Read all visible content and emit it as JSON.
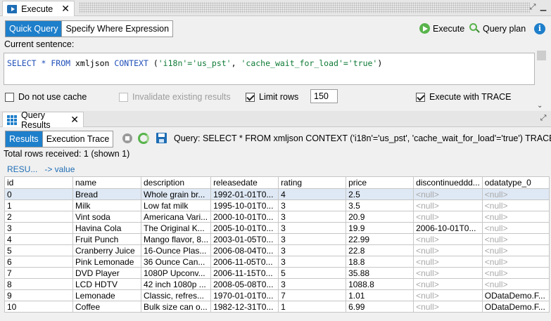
{
  "execute_panel": {
    "tab_title": "Execute",
    "mode_tabs": [
      "Quick Query",
      "Specify Where Expression"
    ],
    "execute_label": "Execute",
    "query_plan_label": "Query plan",
    "info_label": "i",
    "current_sentence_label": "Current sentence:",
    "sql": {
      "kw1": "SELECT",
      "star": "*",
      "kw2": "FROM",
      "table": "xmljson",
      "kw3": "CONTEXT",
      "open": "(",
      "arg1": "'i18n'='us_pst'",
      "comma": ",",
      "arg2": "'cache_wait_for_load'='true'",
      "close": ")"
    },
    "options": {
      "no_cache": "Do not use cache",
      "invalidate": "Invalidate existing results",
      "limit_rows": "Limit rows",
      "limit_value": "150",
      "trace": "Execute with TRACE"
    }
  },
  "results_panel": {
    "tab_title": "Query Results",
    "view_tabs": [
      "Results",
      "Execution Trace"
    ],
    "query_text": "Query: SELECT * FROM xmljson CONTEXT ('i18n'='us_pst', 'cache_wait_for_load'='true') TRACE",
    "total_rows": "Total rows received: 1 (shown 1)",
    "breadcrumb": [
      "RESU...",
      "-> value"
    ],
    "columns": [
      "id",
      "name",
      "description",
      "releasedate",
      "rating",
      "price",
      "discontinueddd...",
      "odatatype_0"
    ],
    "rows": [
      [
        "0",
        "Bread",
        "Whole grain br...",
        "1992-01-01T0...",
        "4",
        "2.5",
        "<null>",
        "<null>"
      ],
      [
        "1",
        "Milk",
        "Low fat milk",
        "1995-10-01T0...",
        "3",
        "3.5",
        "<null>",
        "<null>"
      ],
      [
        "2",
        "Vint soda",
        "Americana Vari...",
        "2000-10-01T0...",
        "3",
        "20.9",
        "<null>",
        "<null>"
      ],
      [
        "3",
        "Havina Cola",
        "The Original K...",
        "2005-10-01T0...",
        "3",
        "19.9",
        "2006-10-01T0...",
        "<null>"
      ],
      [
        "4",
        "Fruit Punch",
        "Mango flavor, 8...",
        "2003-01-05T0...",
        "3",
        "22.99",
        "<null>",
        "<null>"
      ],
      [
        "5",
        "Cranberry Juice",
        "16-Ounce Plas...",
        "2006-08-04T0...",
        "3",
        "22.8",
        "<null>",
        "<null>"
      ],
      [
        "6",
        "Pink Lemonade",
        "36 Ounce Can...",
        "2006-11-05T0...",
        "3",
        "18.8",
        "<null>",
        "<null>"
      ],
      [
        "7",
        "DVD Player",
        "1080P Upconv...",
        "2006-11-15T0...",
        "5",
        "35.88",
        "<null>",
        "<null>"
      ],
      [
        "8",
        "LCD HDTV",
        "42 inch 1080p ...",
        "2008-05-08T0...",
        "3",
        "1088.8",
        "<null>",
        "<null>"
      ],
      [
        "9",
        "Lemonade",
        "Classic, refres...",
        "1970-01-01T0...",
        "7",
        "1.01",
        "<null>",
        "ODataDemo.F..."
      ],
      [
        "10",
        "Coffee",
        "Bulk size can o...",
        "1982-12-31T0...",
        "1",
        "6.99",
        "<null>",
        "ODataDemo.F..."
      ]
    ]
  }
}
